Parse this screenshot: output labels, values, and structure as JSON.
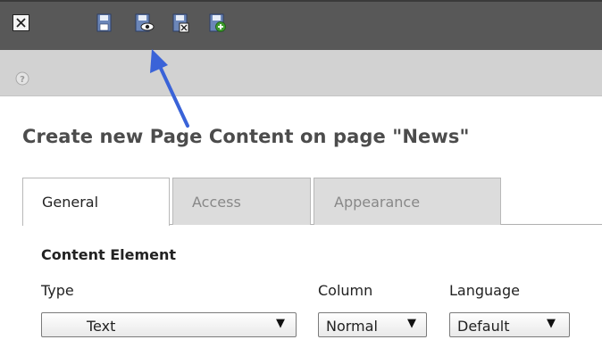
{
  "page_title": "Create new Page Content on page \"News\"",
  "toolbar": {
    "close_icon": "close-icon",
    "buttons": [
      "save-icon",
      "save-and-view-icon",
      "save-and-close-icon",
      "save-and-new-icon"
    ]
  },
  "help_icon": "help-icon",
  "tabs": [
    {
      "label": "General",
      "active": true
    },
    {
      "label": "Access",
      "active": false
    },
    {
      "label": "Appearance",
      "active": false
    }
  ],
  "section": {
    "title": "Content Element"
  },
  "fields": {
    "type": {
      "label": "Type",
      "value": "Text"
    },
    "column": {
      "label": "Column",
      "value": "Normal"
    },
    "language": {
      "label": "Language",
      "value": "Default"
    }
  },
  "select_arrow": "▼",
  "colors": {
    "toolbar_bg": "#585858",
    "subbar_bg": "#d2d2d2",
    "icon_blue": "#6b86b8",
    "annotation_arrow": "#3a63d8"
  }
}
